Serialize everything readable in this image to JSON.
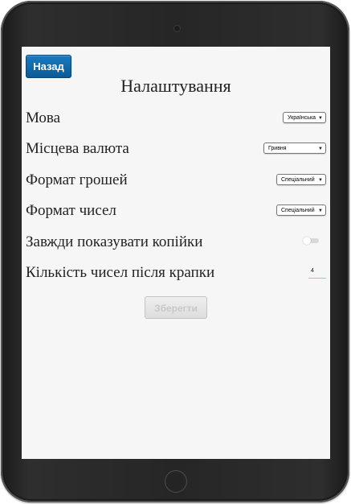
{
  "header": {
    "back_label": "Назад",
    "title": "Налаштування"
  },
  "settings": [
    {
      "label": "Мова",
      "control": "select",
      "value": "Українська"
    },
    {
      "label": "Місцева валюта",
      "control": "select",
      "value": "Гривня"
    },
    {
      "label": "Формат грошей",
      "control": "select",
      "value": "Спеціальний"
    },
    {
      "label": "Формат чисел",
      "control": "select",
      "value": "Спеціальний"
    },
    {
      "label": "Завжди показувати копійки",
      "control": "toggle",
      "value": "off"
    },
    {
      "label": "Кількість чисел після крапки",
      "control": "number",
      "value": "4"
    }
  ],
  "save_label": "Зберегти",
  "colors": {
    "back_button": "#0b5a96",
    "screen_background": "#f6f6f6",
    "device_frame": "#262626"
  }
}
